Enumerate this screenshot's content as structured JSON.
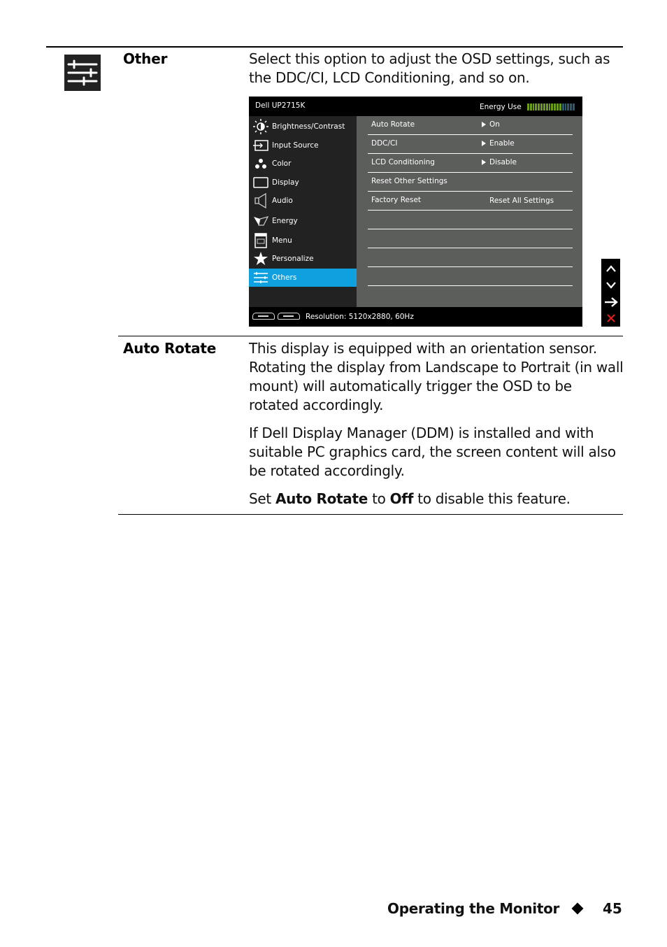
{
  "rows": [
    {
      "term": "Other",
      "icon": "sliders-icon",
      "paragraphs": [
        "Select this option to adjust the OSD settings, such as the DDC/CI, LCD Conditioning, and so on."
      ]
    },
    {
      "term": "Auto Rotate",
      "paragraphs": [
        "This display is equipped with an orientation sensor. Rotating the display from Landscape to Portrait (in wall mount) will automatically trigger the OSD to be rotated accordingly.",
        "If Dell Display Manager (DDM) is installed and with suitable PC graphics card, the screen content will also be rotated accordingly."
      ],
      "last_paragraph": {
        "prefix": "Set ",
        "bold1": "Auto Rotate",
        "middle": " to ",
        "bold2": "Off",
        "suffix": " to disable this feature."
      }
    }
  ],
  "osd": {
    "model": "Dell UP2715K",
    "energy_label": "Energy Use",
    "energy_level_fraction": 0.72,
    "menu": [
      {
        "label": "Brightness/Contrast",
        "icon": "brightness-icon"
      },
      {
        "label": "Input Source",
        "icon": "input-source-icon"
      },
      {
        "label": "Color",
        "icon": "color-icon"
      },
      {
        "label": "Display",
        "icon": "display-icon"
      },
      {
        "label": "Audio",
        "icon": "speaker-icon"
      },
      {
        "label": "Energy",
        "icon": "energy-icon"
      },
      {
        "label": "Menu",
        "icon": "menu-icon"
      },
      {
        "label": "Personalize",
        "icon": "star-icon"
      },
      {
        "label": "Others",
        "icon": "sliders-icon",
        "active": true
      }
    ],
    "options": [
      {
        "label": "Auto Rotate",
        "value": "On"
      },
      {
        "label": "DDC/CI",
        "value": "Enable"
      },
      {
        "label": "LCD Conditioning",
        "value": "Disable"
      },
      {
        "label": "Reset Other Settings",
        "value": ""
      },
      {
        "label": "Factory Reset",
        "value": "Reset All Settings"
      }
    ],
    "resolution": "Resolution: 5120x2880, 60Hz",
    "colors": {
      "active": "#0fa0e0",
      "panel": "#5c5e5c",
      "close": "#e0201c"
    }
  },
  "side_buttons": [
    "up-icon",
    "down-icon",
    "enter-arrow-icon",
    "close-icon"
  ],
  "footer": {
    "section": "Operating the Monitor",
    "page": "45"
  }
}
